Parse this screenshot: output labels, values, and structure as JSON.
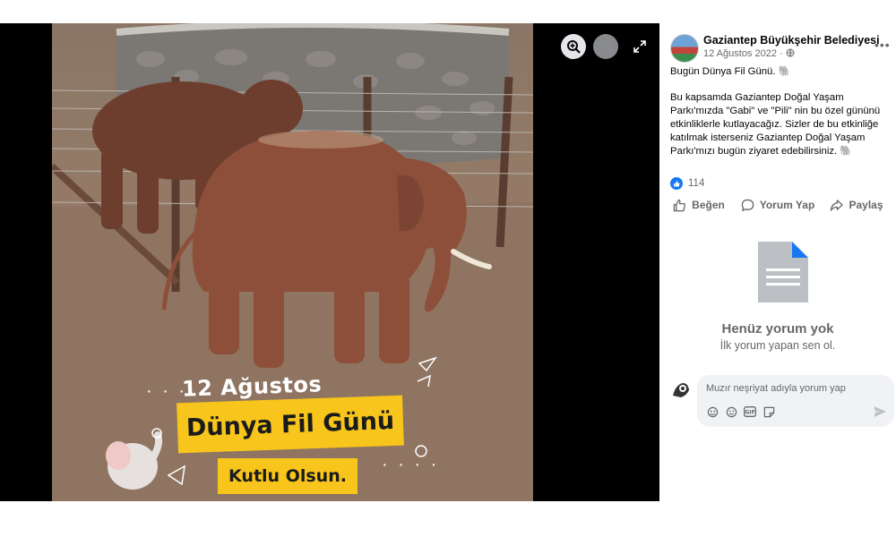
{
  "viewer": {
    "overlay_date": "12 Ağustos",
    "overlay_title": "Dünya Fil Günü",
    "overlay_subtitle": "Kutlu Olsun.",
    "icons": [
      "zoom-in-icon",
      "zoom-out-icon",
      "fullscreen-icon"
    ]
  },
  "post": {
    "page_name": "Gaziantep Büyükşehir Belediyesi",
    "date": "12 Ağustos 2022 ·",
    "line1": "Bugün Dünya Fil Günü. 🐘",
    "line2": "Bu kapsamda Gaziantep Doğal Yaşam Parkı'mızda \"Gabi\" ve \"Pili\" nin bu özel gününü etkinliklerle kutlayacağız. Sizler de bu etkinliğe katılmak isterseniz Gaziantep Doğal Yaşam Parkı'mızı bugün ziyaret edebilirsiniz. 🐘",
    "like_count": "114"
  },
  "actions": {
    "like": "Beğen",
    "comment": "Yorum Yap",
    "share": "Paylaş"
  },
  "comments": {
    "empty_title": "Henüz yorum yok",
    "empty_subtitle": "İlk yorum yapan sen ol.",
    "input_placeholder": "Muzır neşriyat adıyla yorum yap"
  },
  "colors": {
    "accent": "#1877f2",
    "banner": "#f7c51b",
    "secondary_text": "#65676b"
  }
}
